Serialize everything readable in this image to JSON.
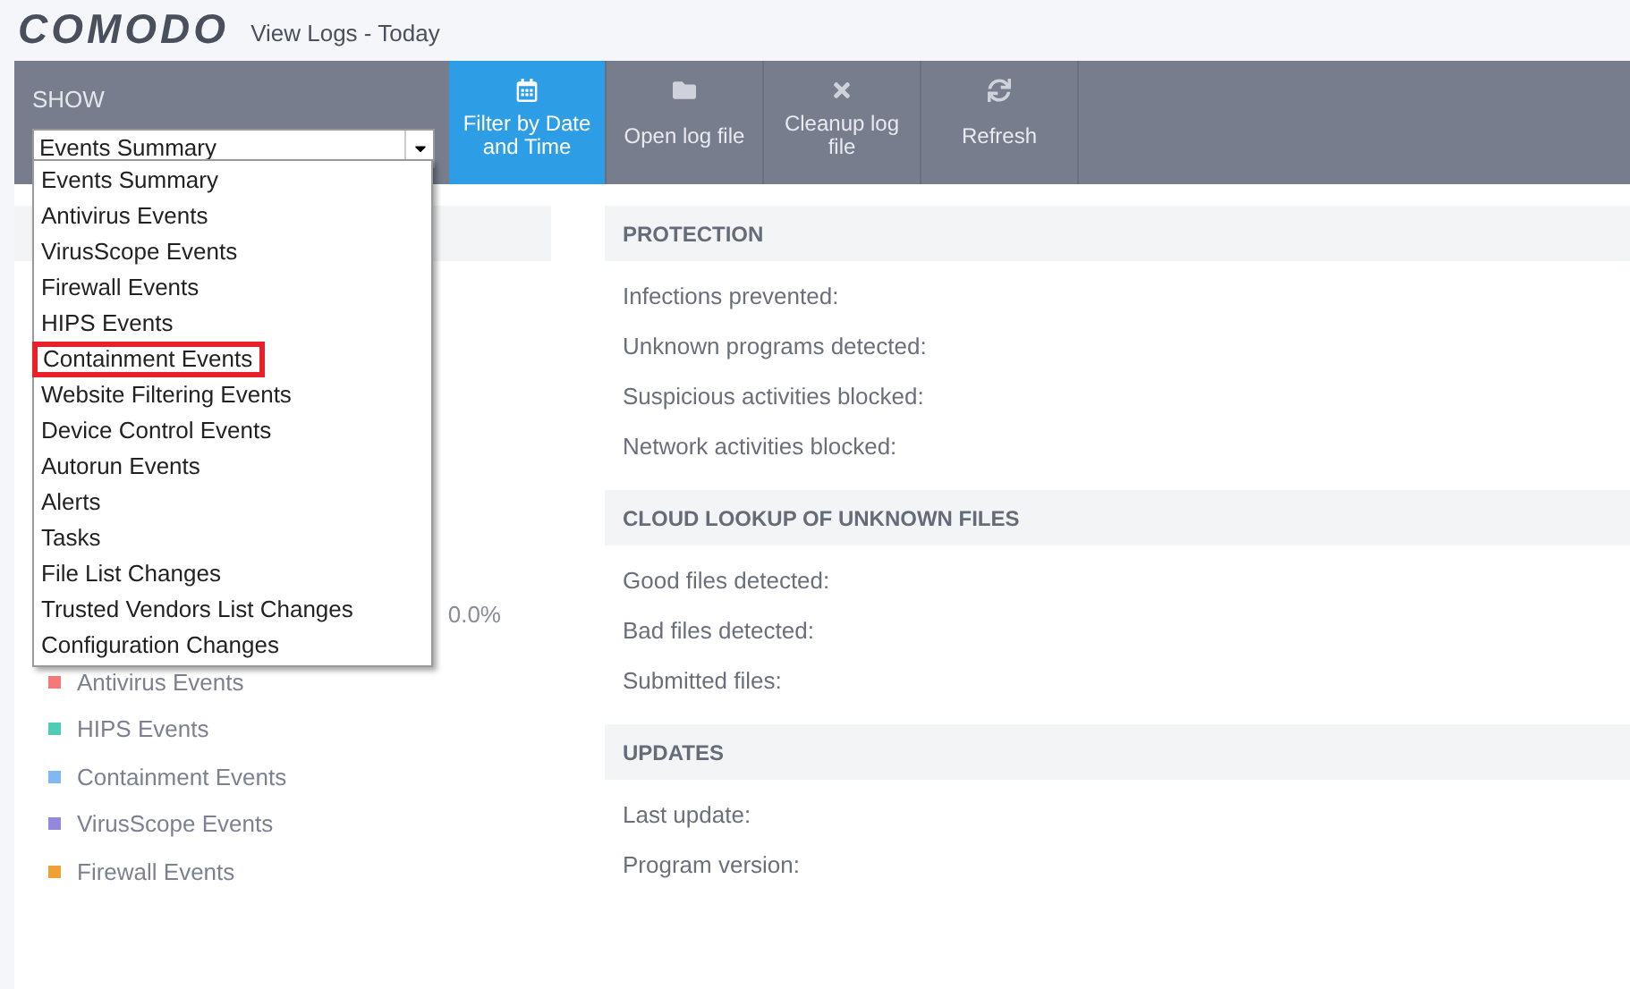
{
  "header": {
    "logo": "COMODO",
    "title": "View Logs - Today"
  },
  "toolbar": {
    "show_label": "SHOW",
    "select_value": "Events Summary",
    "buttons": [
      {
        "label": "Filter by Date and Time",
        "kind": "calendar",
        "selected": true
      },
      {
        "label": "Open log file",
        "kind": "folder",
        "selected": false
      },
      {
        "label": "Cleanup log file",
        "kind": "cross",
        "selected": false
      },
      {
        "label": "Refresh",
        "kind": "refresh",
        "selected": false
      }
    ]
  },
  "dropdown": {
    "items": [
      {
        "label": "Events Summary",
        "marked": false
      },
      {
        "label": "Antivirus Events",
        "marked": false
      },
      {
        "label": "VirusScope Events",
        "marked": false
      },
      {
        "label": "Firewall Events",
        "marked": false
      },
      {
        "label": "HIPS Events",
        "marked": false
      },
      {
        "label": "Containment Events",
        "marked": true
      },
      {
        "label": "Website Filtering Events",
        "marked": false
      },
      {
        "label": "Device Control Events",
        "marked": false
      },
      {
        "label": "Autorun Events",
        "marked": false
      },
      {
        "label": "Alerts",
        "marked": false
      },
      {
        "label": "Tasks",
        "marked": false
      },
      {
        "label": "File List Changes",
        "marked": false
      },
      {
        "label": "Trusted Vendors List Changes",
        "marked": false
      },
      {
        "label": "Configuration Changes",
        "marked": false
      }
    ]
  },
  "chart_panel": {
    "percent": "0.0%",
    "legend": [
      {
        "label": "Antivirus Events",
        "color": "#f47a7a"
      },
      {
        "label": "HIPS Events",
        "color": "#4ecdb4"
      },
      {
        "label": "Containment Events",
        "color": "#82b8f0"
      },
      {
        "label": "VirusScope Events",
        "color": "#9388dc"
      },
      {
        "label": "Firewall Events",
        "color": "#eea236"
      }
    ]
  },
  "sections": [
    {
      "title": "PROTECTION",
      "rows": [
        "Infections prevented:",
        "Unknown programs detected:",
        "Suspicious activities blocked:",
        "Network activities blocked:"
      ]
    },
    {
      "title": "CLOUD LOOKUP OF UNKNOWN FILES",
      "rows": [
        "Good files detected:",
        "Bad files detected:",
        "Submitted files:"
      ]
    },
    {
      "title": "UPDATES",
      "rows": [
        "Last update:",
        "Program version:"
      ]
    }
  ]
}
